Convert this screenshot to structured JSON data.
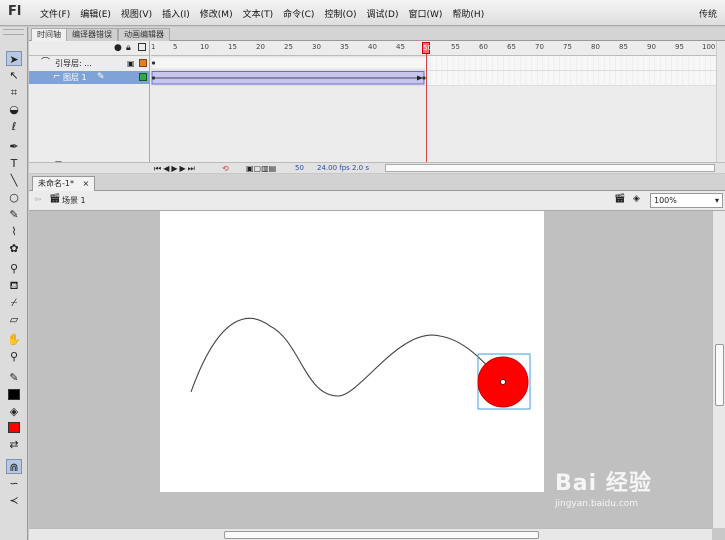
{
  "app": {
    "logo": "Fl",
    "workspace": "传统"
  },
  "menu": [
    "文件(F)",
    "编辑(E)",
    "视图(V)",
    "插入(I)",
    "修改(M)",
    "文本(T)",
    "命令(C)",
    "控制(O)",
    "调试(D)",
    "窗口(W)",
    "帮助(H)"
  ],
  "panel_tabs": [
    "时间轴",
    "编译器错误",
    "动画编辑器"
  ],
  "timeline": {
    "ruler": [
      "1",
      "5",
      "10",
      "15",
      "20",
      "25",
      "30",
      "35",
      "40",
      "45",
      "50",
      "55",
      "60",
      "65",
      "70",
      "75",
      "80",
      "85",
      "90",
      "95",
      "100",
      "10"
    ],
    "current_frame": "50",
    "layers": [
      {
        "name": "引导层: ...",
        "selected": false,
        "color": "#e08020"
      },
      {
        "name": "图层 1",
        "selected": true,
        "color": "#2faa4a"
      }
    ],
    "status": {
      "frame": "50",
      "fps": "24.00 fps",
      "time": "2.0 s"
    }
  },
  "document": {
    "tab": "未命名-1*",
    "scene": "场景 1",
    "zoom": "100%"
  },
  "stage": {
    "ball_color": "#ff0000",
    "ball_outline": "#cc0000",
    "bbox_color": "#3aa0d8"
  },
  "tools": {
    "stroke_color": "#000000",
    "fill_color": "#ff0000"
  },
  "watermark": {
    "brand": "Bai 经验",
    "url": "jingyan.baidu.com"
  }
}
